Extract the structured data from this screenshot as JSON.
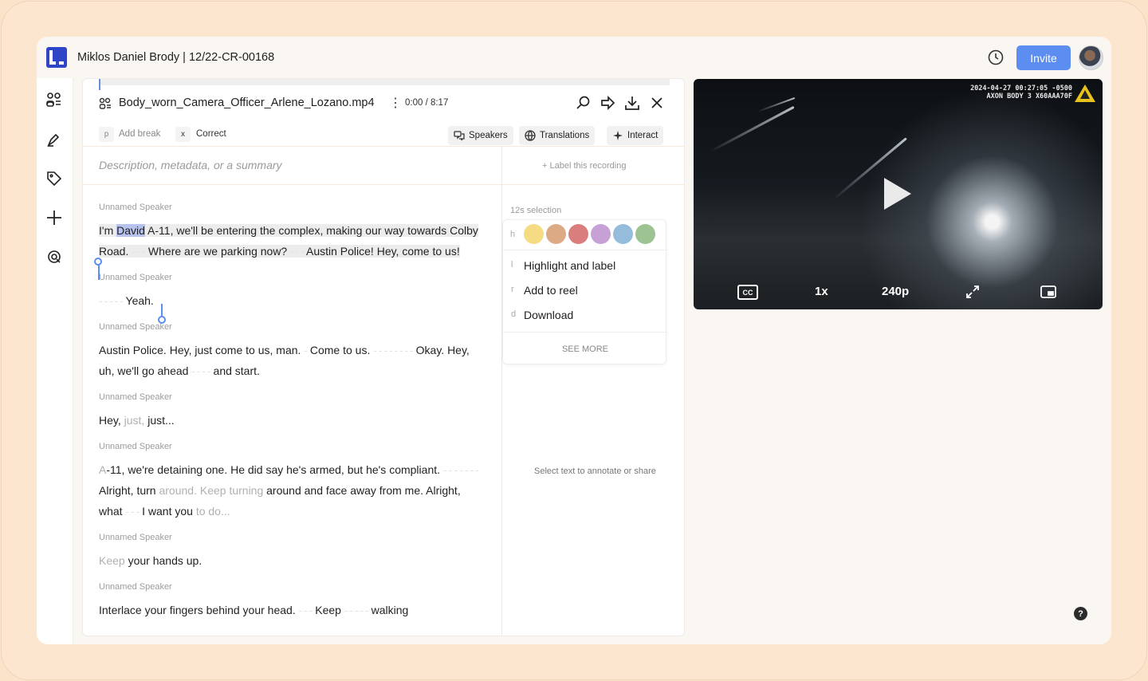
{
  "header": {
    "title": "Miklos Daniel Brody | 12/22-CR-00168",
    "invite_label": "Invite"
  },
  "sidebar": {
    "items": [
      {
        "name": "people-icon"
      },
      {
        "name": "pen-icon"
      },
      {
        "name": "tag-icon"
      },
      {
        "name": "plus-icon"
      },
      {
        "name": "search-icon"
      }
    ]
  },
  "recording": {
    "filename": "Body_worn_Camera_Officer_Arlene_Lozano.mp4",
    "time": "0:00 / 8:17",
    "add_break_key": "p",
    "add_break_label": "Add break",
    "correct_key": "x",
    "correct_label": "Correct",
    "speakers_label": "Speakers",
    "translations_label": "Translations",
    "interact_label": "Interact",
    "description_placeholder": "Description, metadata, or a summary",
    "label_recording": "+ Label this recording"
  },
  "transcript": {
    "speaker": "Unnamed Speaker",
    "b1_a": "I'm ",
    "b1_hl": "David",
    "b1_b": " A-11, we'll be entering the complex, making our way towards Colby Road. ",
    "b1_c": " Where are we parking now? ",
    "b1_d": " Austin Police! Hey, come to us!",
    "b2": " Yeah.",
    "b3_a": "Austin Police. Hey, just come to us, man. ",
    "b3_b": " Come to us. ",
    "b3_c": " Okay. Hey, uh, we'll go ahead ",
    "b3_d": " and start.",
    "b4_a": "Hey, ",
    "b4_f": "just,",
    "b4_b": " just...",
    "b5_a_f": "A",
    "b5_a": "-11, we're detaining one. He did say he's armed, but he's compliant. ",
    "b5_b": " Alright, turn ",
    "b5_f1": "around. Keep turning",
    "b5_c": " around and face away from me. Alright, what ",
    "b5_d": " I want you ",
    "b5_f2": "to do...",
    "b6_f": "Keep",
    "b6_a": " your hands up.",
    "b7": "Interlace your fingers behind your head. ",
    "b7_b": " Keep ",
    "b7_c": " walking"
  },
  "annotate": {
    "selection_caption": "12s selection",
    "swatch_key": "h",
    "swatch_colors": [
      "#f5dc84",
      "#dcab86",
      "#d97d7d",
      "#c7a1d6",
      "#95bddb",
      "#9cc391"
    ],
    "menu": [
      {
        "key": "l",
        "label": "Highlight and label"
      },
      {
        "key": "r",
        "label": "Add to reel"
      },
      {
        "key": "d",
        "label": "Download"
      }
    ],
    "see_more": "SEE MORE",
    "hint": "Select text to annotate or share"
  },
  "video": {
    "osd_line1": "2024-04-27 00:27:05 -0500",
    "osd_line2": "AXON BODY 3 X60AAA70F",
    "cc_label": "CC",
    "speed": "1x",
    "quality": "240p"
  },
  "help_label": "?"
}
